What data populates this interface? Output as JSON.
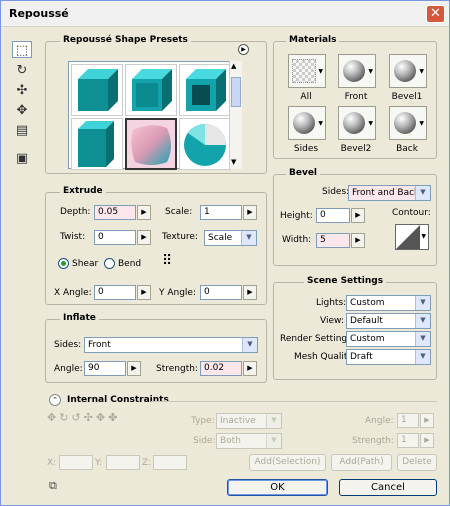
{
  "window": {
    "title": "Repoussé",
    "close_icon": "close-icon"
  },
  "tools": [
    "shape-preset-icon",
    "rotate-3d-icon",
    "roll-3d-icon",
    "pan-3d-icon",
    "slide-3d-icon",
    "scale-3d-icon",
    "camera-icon"
  ],
  "presets": {
    "title": "Repoussé Shape Presets",
    "count": 6
  },
  "materials": {
    "title": "Materials",
    "items": [
      "All",
      "Front",
      "Bevel1",
      "Sides",
      "Bevel2",
      "Back"
    ]
  },
  "extrude": {
    "title": "Extrude",
    "depth_label": "Depth:",
    "depth": "0.05",
    "scale_label": "Scale:",
    "scale": "1",
    "twist_label": "Twist:",
    "twist": "0",
    "texture_label": "Texture:",
    "texture": "Scale",
    "shear_label": "Shear",
    "bend_label": "Bend",
    "xangle_label": "X Angle:",
    "xangle": "0",
    "yangle_label": "Y Angle:",
    "yangle": "0"
  },
  "bevel": {
    "title": "Bevel",
    "sides_label": "Sides:",
    "sides": "Front and Back",
    "height_label": "Height:",
    "height": "0",
    "width_label": "Width:",
    "width": "5",
    "contour_label": "Contour:"
  },
  "inflate": {
    "title": "Inflate",
    "sides_label": "Sides:",
    "sides": "Front",
    "angle_label": "Angle:",
    "angle": "90",
    "strength_label": "Strength:",
    "strength": "0.02"
  },
  "scene": {
    "title": "Scene Settings",
    "lights_label": "Lights:",
    "lights": "Custom",
    "view_label": "View:",
    "view": "Default",
    "render_label": "Render Settings:",
    "render": "Custom",
    "mesh_label": "Mesh Quality:",
    "mesh": "Draft"
  },
  "constraints": {
    "title": "Internal Constraints",
    "type_label": "Type:",
    "type": "Inactive",
    "side_label": "Side:",
    "side": "Both",
    "angle_label": "Angle:",
    "angle": "1",
    "strength_label": "Strength:",
    "strength": "1",
    "x_label": "X:",
    "y_label": "Y:",
    "z_label": "Z:",
    "add_selection": "Add(Selection)",
    "add_path": "Add(Path)",
    "delete": "Delete"
  },
  "buttons": {
    "ok": "OK",
    "cancel": "Cancel"
  },
  "colors": {
    "teal": "#14aab0",
    "accent": "#d7573a"
  }
}
